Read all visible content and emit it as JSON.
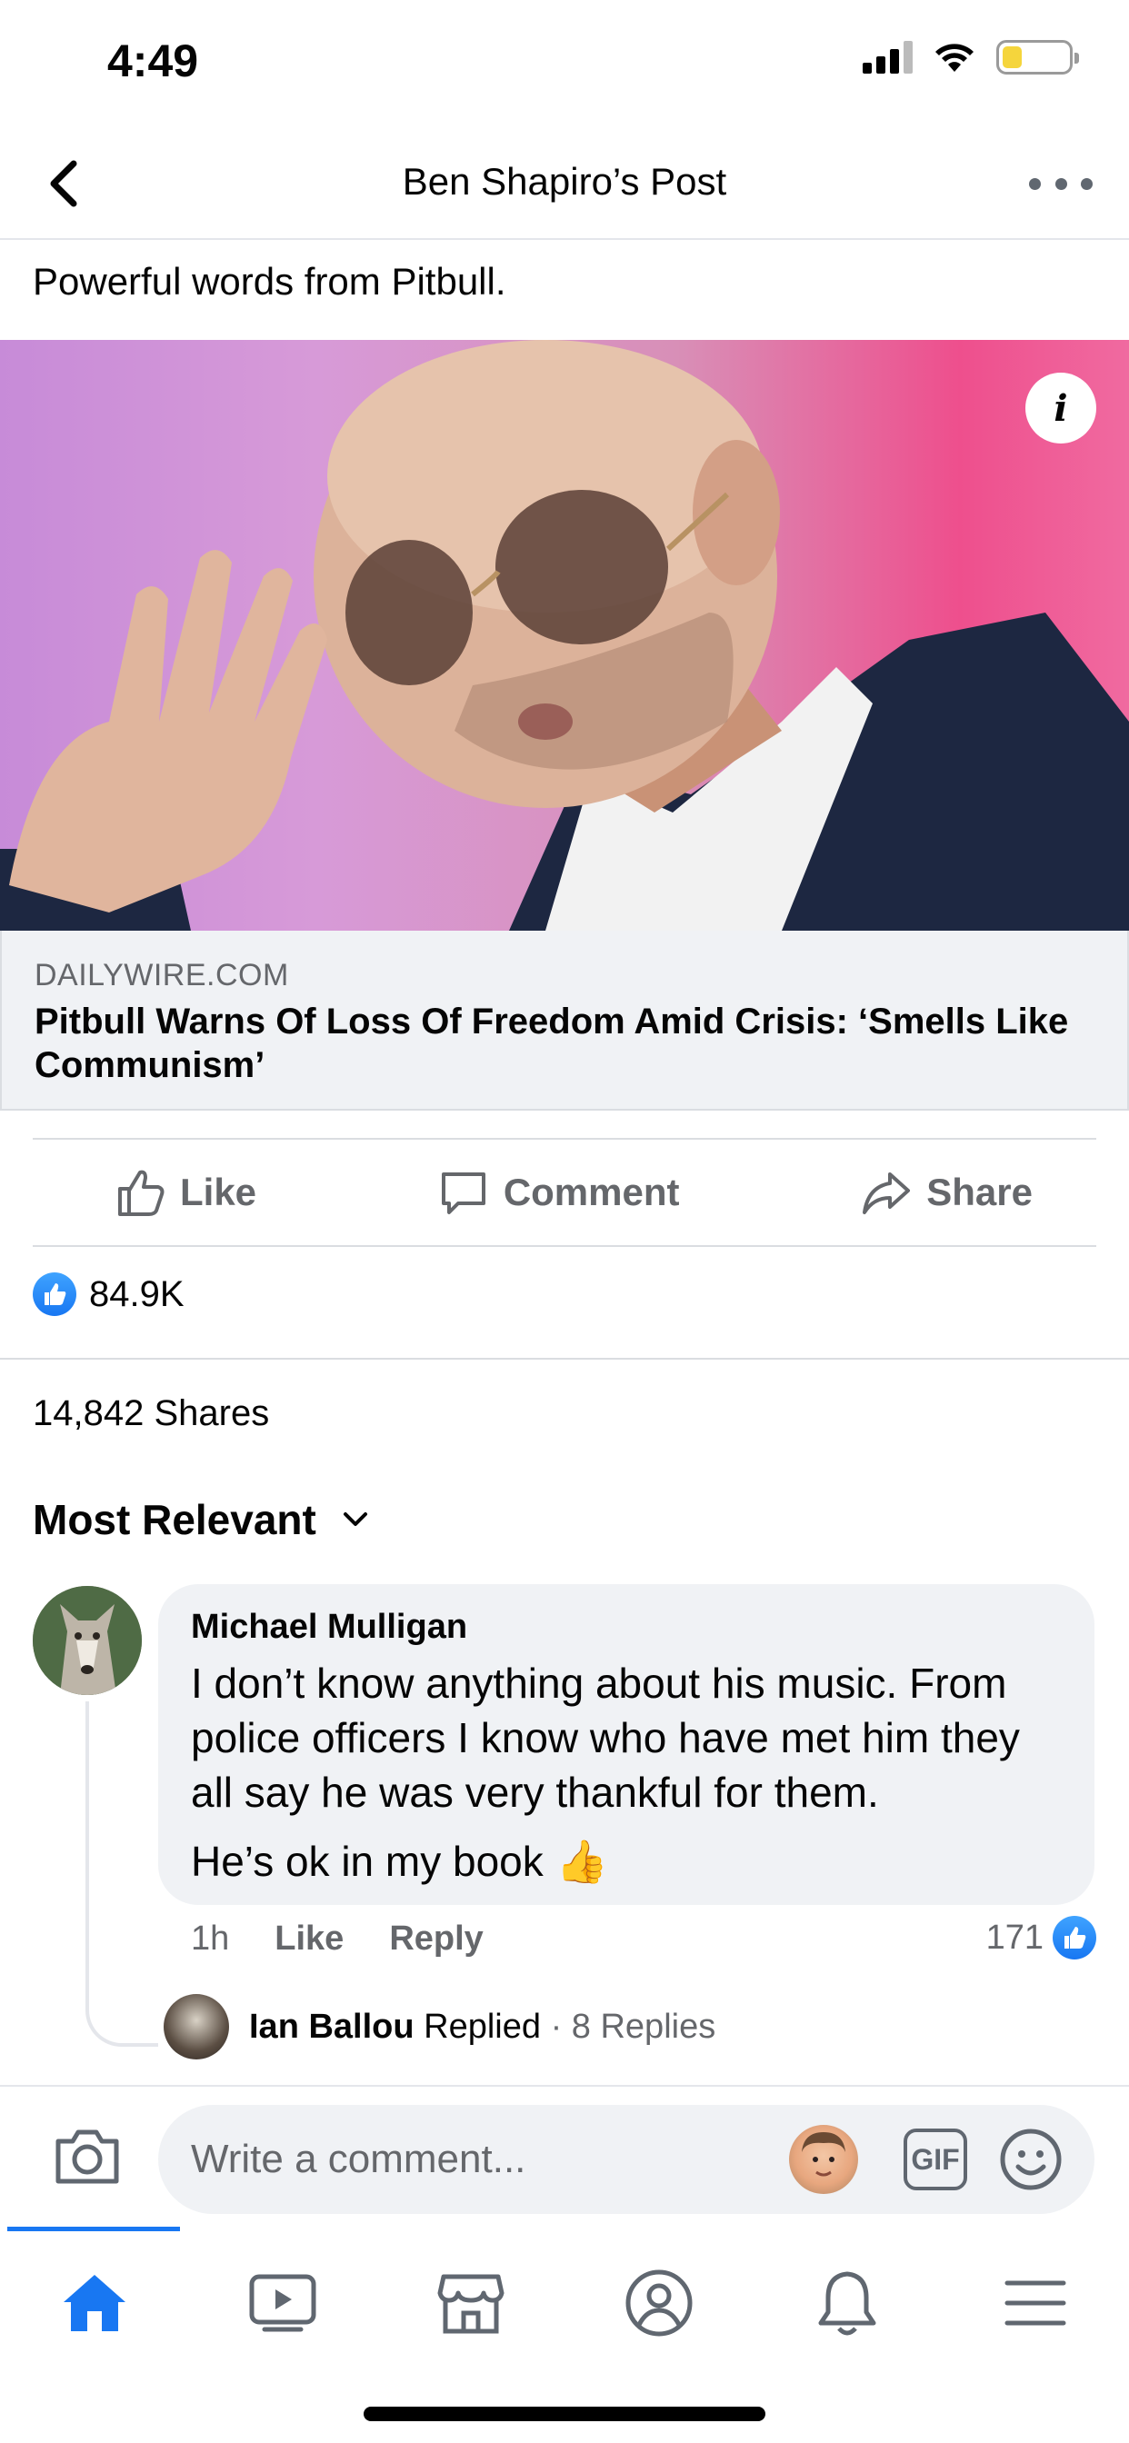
{
  "status_bar": {
    "time": "4:49",
    "icons": [
      "cellular-signal",
      "wifi",
      "battery-low"
    ]
  },
  "header": {
    "title": "Ben Shapiro’s Post",
    "back_icon": "chevron-left",
    "more_icon": "ellipsis"
  },
  "post": {
    "text": "Powerful words from Pitbull.",
    "image_alt": "Pitbull wearing aviator sunglasses and a dark blazer, raising his hand",
    "link": {
      "domain": "DAILYWIRE.COM",
      "title": "Pitbull Warns Of Loss Of Freedom Amid Crisis: ‘Smells Like Communism’"
    }
  },
  "actions": {
    "like": "Like",
    "comment": "Comment",
    "share": "Share"
  },
  "reactions": {
    "count": "84.9K"
  },
  "shares": "14,842 Shares",
  "sort": {
    "label": "Most Relevant"
  },
  "comment": {
    "author": "Michael Mulligan",
    "text": "I don’t know anything about his music. From police officers I know who have met him they all say he was very thankful for them.",
    "text_2": "He’s ok in my book",
    "emoji": "👍",
    "time": "1h",
    "like": "Like",
    "reply": "Reply",
    "likes_count": "171",
    "reply_preview": {
      "name": "Ian Ballou",
      "replied": "Replied",
      "replies": "· 8 Replies"
    }
  },
  "composer": {
    "placeholder": "Write a comment...",
    "gif": "GIF"
  },
  "tabbar": {
    "tabs": [
      "home",
      "watch",
      "marketplace",
      "profile",
      "notifications",
      "menu"
    ],
    "active": "home",
    "accent_color": "#1877f2"
  }
}
